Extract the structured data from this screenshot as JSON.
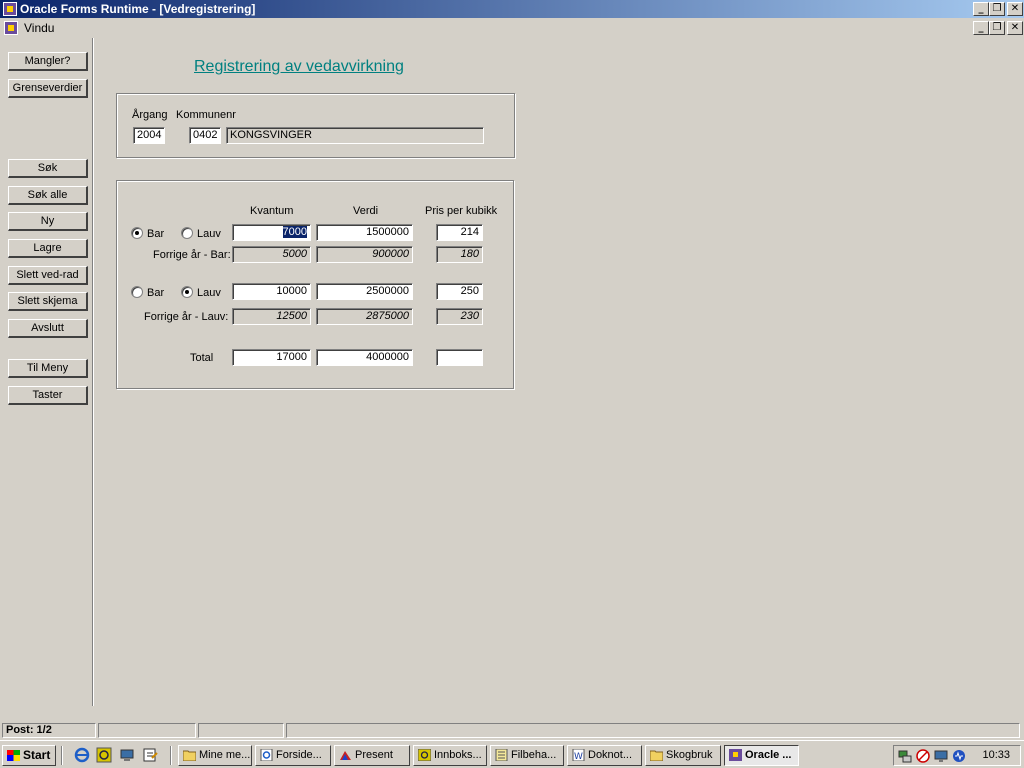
{
  "window": {
    "title": "Oracle Forms Runtime - [Vedregistrering]",
    "menu_label": "Vindu",
    "minimize_glyph": "_",
    "restore_glyph": "❐",
    "close_glyph": "✕"
  },
  "sidebar": {
    "buttons": [
      "Mangler?",
      "Grenseverdier",
      "Søk",
      "Søk alle",
      "Ny",
      "Lagre",
      "Slett ved-rad",
      "Slett skjema",
      "Avslutt",
      "Til Meny",
      "Taster"
    ]
  },
  "form": {
    "heading": "Registrering av vedavvirkning",
    "header": {
      "aargang_label": "Årgang",
      "kommunenr_label": "Kommunenr",
      "aargang_value": "2004",
      "kommunenr_value": "0402",
      "kommune_name": "KONGSVINGER"
    },
    "columns": {
      "kvantum": "Kvantum",
      "verdi": "Verdi",
      "pris": "Pris per kubikk"
    },
    "row1": {
      "radio_bar_label": "Bar",
      "radio_lauv_label": "Lauv",
      "selected": "Bar",
      "kvantum": "7000",
      "verdi": "1500000",
      "pris": "214"
    },
    "prev1": {
      "label": "Forrige år - Bar:",
      "kvantum": "5000",
      "verdi": "900000",
      "pris": "180"
    },
    "row2": {
      "radio_bar_label": "Bar",
      "radio_lauv_label": "Lauv",
      "selected": "Lauv",
      "kvantum": "10000",
      "verdi": "2500000",
      "pris": "250"
    },
    "prev2": {
      "label": "Forrige år - Lauv:",
      "kvantum": "12500",
      "verdi": "2875000",
      "pris": "230"
    },
    "total": {
      "label": "Total",
      "kvantum": "17000",
      "verdi": "4000000",
      "pris": ""
    }
  },
  "status": {
    "post": "Post: 1/2"
  },
  "taskbar": {
    "start_label": "Start",
    "quicklaunch_icons": [
      "internet-explorer-icon",
      "outlook-icon",
      "desktop-icon",
      "notepad-icon"
    ],
    "tasks": [
      {
        "label": "Mine me...",
        "icon": "folder-icon"
      },
      {
        "label": "Forside...",
        "icon": "internet-explorer-icon"
      },
      {
        "label": "Present",
        "icon": "presentation-icon"
      },
      {
        "label": "Innboks...",
        "icon": "outlook-icon"
      },
      {
        "label": "Filbeha...",
        "icon": "file-manager-icon"
      },
      {
        "label": "Doknot...",
        "icon": "word-icon"
      },
      {
        "label": "Skogbruk",
        "icon": "folder-icon"
      },
      {
        "label": "Oracle ...",
        "icon": "oracle-forms-icon",
        "active": true
      }
    ],
    "clock": "10:33"
  }
}
